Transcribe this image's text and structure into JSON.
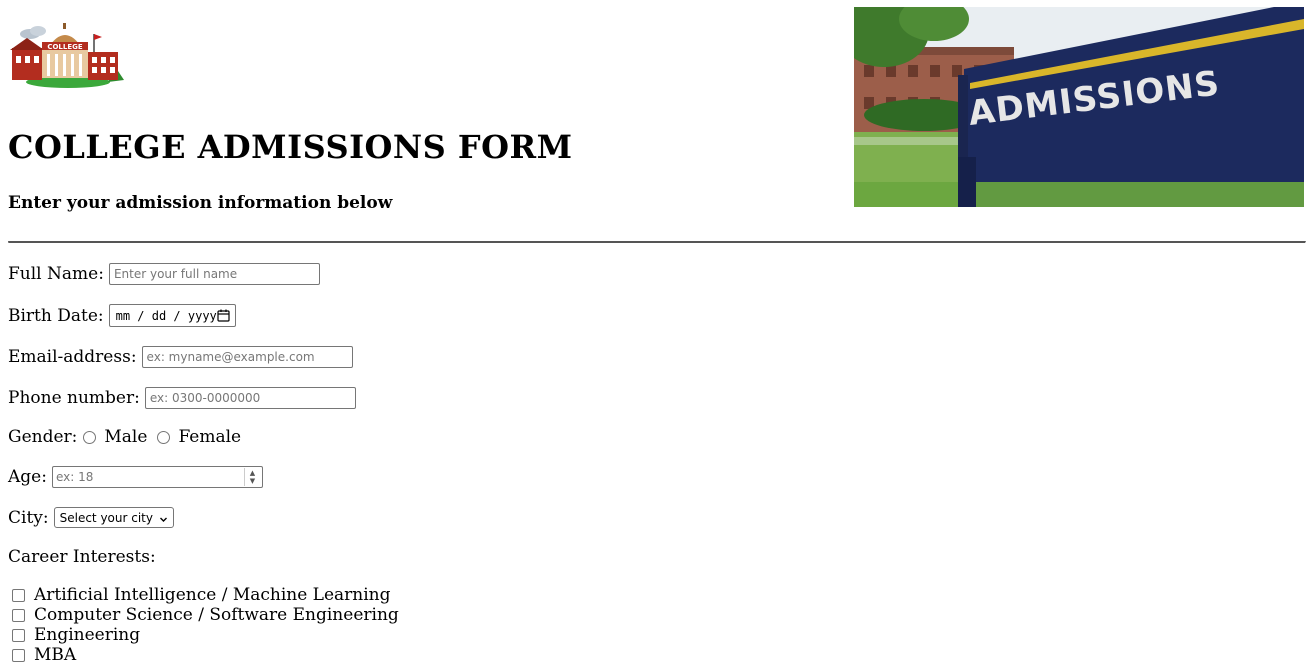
{
  "header": {
    "title": "COLLEGE ADMISSIONS FORM",
    "subtitle": "Enter your admission information below",
    "logo_text": "COLLEGE",
    "banner_text": "ADMISSIONS"
  },
  "form": {
    "full_name": {
      "label": "Full Name:",
      "placeholder": "Enter your full name",
      "value": ""
    },
    "birth_date": {
      "label": "Birth Date:",
      "placeholder": "mm / dd / yyyy",
      "icon": "calendar-icon"
    },
    "email": {
      "label": "Email-address:",
      "placeholder": "ex: myname@example.com",
      "value": ""
    },
    "phone": {
      "label": "Phone number:",
      "placeholder": "ex: 0300-0000000",
      "value": ""
    },
    "gender": {
      "label": "Gender:",
      "options": [
        "Male",
        "Female"
      ],
      "selected": null
    },
    "age": {
      "label": "Age:",
      "placeholder": "ex: 18",
      "value": ""
    },
    "city": {
      "label": "City:",
      "selected": "Select your city"
    },
    "career_interests": {
      "label": "Career Interests:",
      "options": [
        "Artificial Intelligence / Machine Learning",
        "Computer Science / Software Engineering",
        "Engineering",
        "MBA"
      ]
    }
  },
  "colors": {
    "rule": "#555555",
    "input_border": "#767676",
    "banner_sign": "#1c2a5e",
    "banner_stripe": "#d9b62a"
  }
}
